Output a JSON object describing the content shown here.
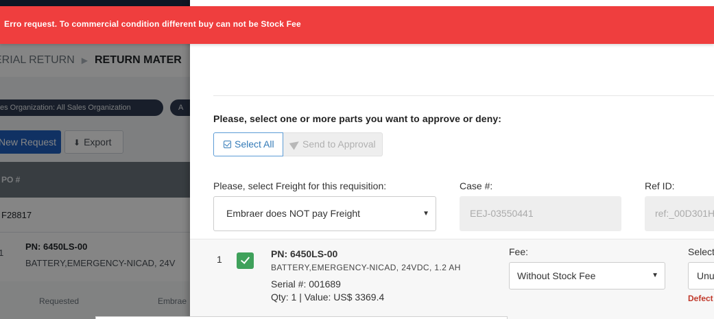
{
  "background": {
    "breadcrumb": {
      "first": "ERIAL RETURN",
      "current": "RETURN MATER"
    },
    "filters": {
      "chip1": "es Organization: All Sales Organization",
      "chip2": "A"
    },
    "buttons": {
      "new_request": "New Request",
      "export": "Export"
    },
    "table": {
      "header": "PO #",
      "row1_value": "F28817",
      "row2": {
        "index": "1",
        "pn": "PN: 6450LS-00",
        "description": "BATTERY,EMERGENCY-NICAD, 24V"
      },
      "subheaders": [
        "Requested",
        "Embrae"
      ]
    }
  },
  "toast": {
    "message": "Erro request. To commercial condition different buy can not be Stock Fee",
    "color": "#ef3e3e"
  },
  "modal": {
    "prompt": "Please, select one or more parts you want to approve or deny:",
    "select_all_label": "Select All",
    "send_label": "Send to Approval",
    "freight": {
      "label": "Please, select Freight for this requisition:",
      "value": "Embraer does NOT pay Freight"
    },
    "case": {
      "label": "Case #:",
      "value": "EEJ-03550441"
    },
    "ref": {
      "label": "Ref ID:",
      "value": "ref:_00D301H"
    },
    "part": {
      "index": "1",
      "pn": "PN: 6450LS-00",
      "description": "BATTERY,EMERGENCY-NICAD, 24VDC, 1.2 AH",
      "serial": "Serial #: 001689",
      "qty_value": "Qty: 1 | Value: US$ 3369.4",
      "fee_label": "Fee:",
      "fee_value": "Without Stock Fee",
      "select_label": "Select",
      "select_value": "Unu",
      "defect_label": "Defect"
    }
  },
  "icons": {
    "dropdown_caret": "▼"
  }
}
